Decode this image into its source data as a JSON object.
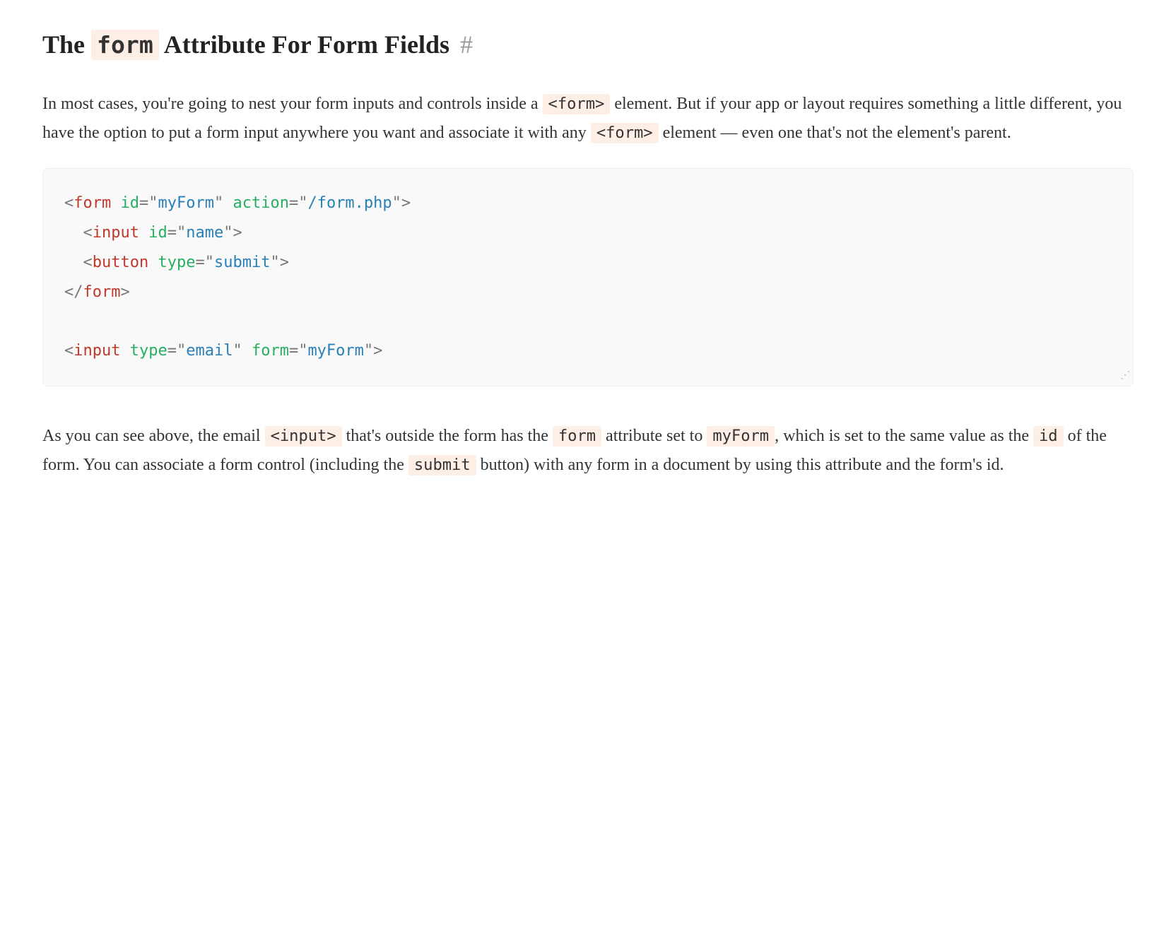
{
  "heading": {
    "prefix": "The ",
    "code": "form",
    "suffix": " Attribute For Form Fields ",
    "anchor": "#"
  },
  "para1": {
    "t1": "In most cases, you're going to nest your form inputs and controls inside a ",
    "c1": "<form>",
    "t2": " element. But if your app or layout requires something a little different, you have the option to put a form input anywhere you want and associate it with any ",
    "c2": "<form>",
    "t3": " element — even one that's not the element's parent."
  },
  "code": {
    "l1": {
      "open": "<",
      "tag": "form",
      "sp1": " ",
      "attr1": "id",
      "eq1": "=",
      "q1a": "\"",
      "val1": "myForm",
      "q1b": "\"",
      "sp2": " ",
      "attr2": "action",
      "eq2": "=",
      "q2a": "\"",
      "val2": "/form.php",
      "q2b": "\"",
      "close": ">"
    },
    "l2": {
      "indent": "  ",
      "open": "<",
      "tag": "input",
      "sp1": " ",
      "attr1": "id",
      "eq1": "=",
      "q1a": "\"",
      "val1": "name",
      "q1b": "\"",
      "close": ">"
    },
    "l3": {
      "indent": "  ",
      "open": "<",
      "tag": "button",
      "sp1": " ",
      "attr1": "type",
      "eq1": "=",
      "q1a": "\"",
      "val1": "submit",
      "q1b": "\"",
      "close": ">"
    },
    "l4": {
      "open": "</",
      "tag": "form",
      "close": ">"
    },
    "l5": "",
    "l6": {
      "open": "<",
      "tag": "input",
      "sp1": " ",
      "attr1": "type",
      "eq1": "=",
      "q1a": "\"",
      "val1": "email",
      "q1b": "\"",
      "sp2": " ",
      "attr2": "form",
      "eq2": "=",
      "q2a": "\"",
      "val2": "myForm",
      "q2b": "\"",
      "close": ">"
    }
  },
  "para2": {
    "t1": "As you can see above, the email ",
    "c1": "<input>",
    "t2": " that's outside the form has the ",
    "c2": "form",
    "t3": " attribute set to ",
    "c3": "myForm",
    "t4": ", which is set to the same value as the ",
    "c4": "id",
    "t5": " of the form. You can associate a form control (including the ",
    "c5": "submit",
    "t6": " button) with any form in a document by using this attribute and the form's id."
  }
}
